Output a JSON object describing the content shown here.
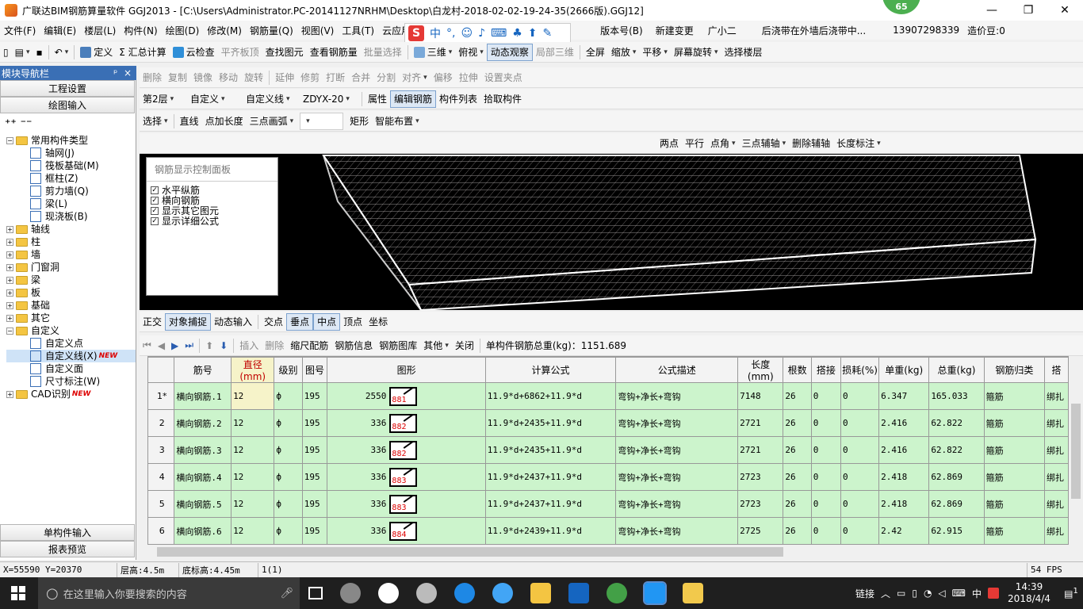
{
  "title": {
    "text": "广联达BIM钢筋算量软件 GGJ2013 - [C:\\Users\\Administrator.PC-20141127NRHM\\Desktop\\白龙村-2018-02-02-19-24-35(2666版).GGJ12]",
    "badge": "65",
    "minimize": "—",
    "restore": "❐",
    "close": "✕"
  },
  "menu": {
    "items": [
      "文件(F)",
      "编辑(E)",
      "楼层(L)",
      "构件(N)",
      "绘图(D)",
      "修改(M)",
      "钢筋量(Q)",
      "视图(V)",
      "工具(T)",
      "云应用"
    ],
    "right_items": [
      "版本号(B)",
      "新建变更",
      "广小二",
      "后浇带在外墙后浇带中...",
      "13907298339",
      "造价豆:0"
    ],
    "ime_s": "S",
    "ime_zh": "中"
  },
  "toolbar1": [
    "定义",
    "Σ 汇总计算",
    "云检查",
    "平齐板顶",
    "查找图元",
    "查看钢筋量",
    "批量选择",
    "三维",
    "俯视",
    "动态观察",
    "局部三维",
    "全屏",
    "缩放",
    "平移",
    "屏幕旋转",
    "选择楼层"
  ],
  "toolbar2": [
    "删除",
    "复制",
    "镜像",
    "移动",
    "旋转",
    "延伸",
    "修剪",
    "打断",
    "合并",
    "分割",
    "对齐",
    "偏移",
    "拉伸",
    "设置夹点"
  ],
  "toolbar3": {
    "floor": "第2层",
    "type": "自定义",
    "subtype": "自定义线",
    "name": "ZDYX-20",
    "buttons": [
      "属性",
      "编辑钢筋",
      "构件列表",
      "拾取构件"
    ]
  },
  "toolbar4": [
    "选择",
    "直线",
    "点加长度",
    "三点画弧",
    "矩形",
    "智能布置"
  ],
  "toolbar5": [
    "两点",
    "平行",
    "点角",
    "三点辅轴",
    "删除辅轴",
    "长度标注"
  ],
  "nav": {
    "header": "模块导航栏",
    "pin": "ᵖ",
    "close": "×",
    "buttons_top": [
      "工程设置",
      "绘图输入"
    ],
    "buttons_bottom": [
      "单构件输入",
      "报表预览"
    ],
    "common_group": "常用构件类型",
    "common_items": [
      "轴网(J)",
      "筏板基础(M)",
      "框柱(Z)",
      "剪力墙(Q)",
      "梁(L)",
      "现浇板(B)"
    ],
    "groups": [
      "轴线",
      "柱",
      "墙",
      "门窗洞",
      "梁",
      "板",
      "基础",
      "其它"
    ],
    "custom_group": "自定义",
    "custom_items": [
      "自定义点",
      "自定义线(X)",
      "自定义面",
      "尺寸标注(W)"
    ],
    "cad": "CAD识别",
    "new_tag": "NEW"
  },
  "panel": {
    "title": "钢筋显示控制面板",
    "checks": [
      "水平纵筋",
      "横向钢筋",
      "显示其它图元",
      "显示详细公式"
    ]
  },
  "snapbar": [
    "正交",
    "对象捕捉",
    "动态输入",
    "交点",
    "垂点",
    "中点",
    "顶点",
    "坐标"
  ],
  "gridbar": {
    "buttons": [
      "插入",
      "删除",
      "缩尺配筋",
      "钢筋信息",
      "钢筋图库",
      "其他",
      "关闭"
    ],
    "total_label": "单构件钢筋总重(kg)：1151.689"
  },
  "grid": {
    "headers": [
      "筋号",
      "直径(mm)",
      "级别",
      "图号",
      "图形",
      "计算公式",
      "公式描述",
      "长度(mm)",
      "根数",
      "搭接",
      "损耗(%)",
      "单重(kg)",
      "总重(kg)",
      "钢筋归类",
      "搭"
    ],
    "rows": [
      {
        "no": "1*",
        "name": "横向钢筋.1",
        "dia": "12",
        "grade": "ф",
        "fig": "195",
        "len_shape": "2550",
        "code": "881",
        "formula": "11.9*d+6862+11.9*d",
        "desc": "弯钩+净长+弯钩",
        "length": "7148",
        "count": "26",
        "lap": "0",
        "loss": "0",
        "unit": "6.347",
        "total": "165.033",
        "cat": "箍筋",
        "tie": "绑扎"
      },
      {
        "no": "2",
        "name": "横向钢筋.2",
        "dia": "12",
        "grade": "ф",
        "fig": "195",
        "len_shape": "336",
        "code": "882",
        "formula": "11.9*d+2435+11.9*d",
        "desc": "弯钩+净长+弯钩",
        "length": "2721",
        "count": "26",
        "lap": "0",
        "loss": "0",
        "unit": "2.416",
        "total": "62.822",
        "cat": "箍筋",
        "tie": "绑扎"
      },
      {
        "no": "3",
        "name": "横向钢筋.3",
        "dia": "12",
        "grade": "ф",
        "fig": "195",
        "len_shape": "336",
        "code": "882",
        "formula": "11.9*d+2435+11.9*d",
        "desc": "弯钩+净长+弯钩",
        "length": "2721",
        "count": "26",
        "lap": "0",
        "loss": "0",
        "unit": "2.416",
        "total": "62.822",
        "cat": "箍筋",
        "tie": "绑扎"
      },
      {
        "no": "4",
        "name": "横向钢筋.4",
        "dia": "12",
        "grade": "ф",
        "fig": "195",
        "len_shape": "336",
        "code": "883",
        "formula": "11.9*d+2437+11.9*d",
        "desc": "弯钩+净长+弯钩",
        "length": "2723",
        "count": "26",
        "lap": "0",
        "loss": "0",
        "unit": "2.418",
        "total": "62.869",
        "cat": "箍筋",
        "tie": "绑扎"
      },
      {
        "no": "5",
        "name": "横向钢筋.5",
        "dia": "12",
        "grade": "ф",
        "fig": "195",
        "len_shape": "336",
        "code": "883",
        "formula": "11.9*d+2437+11.9*d",
        "desc": "弯钩+净长+弯钩",
        "length": "2723",
        "count": "26",
        "lap": "0",
        "loss": "0",
        "unit": "2.418",
        "total": "62.869",
        "cat": "箍筋",
        "tie": "绑扎"
      },
      {
        "no": "6",
        "name": "横向钢筋.6",
        "dia": "12",
        "grade": "ф",
        "fig": "195",
        "len_shape": "336",
        "code": "884",
        "formula": "11.9*d+2439+11.9*d",
        "desc": "弯钩+净长+弯钩",
        "length": "2725",
        "count": "26",
        "lap": "0",
        "loss": "0",
        "unit": "2.42",
        "total": "62.915",
        "cat": "箍筋",
        "tie": "绑扎"
      }
    ]
  },
  "status": {
    "coords": "X=55590 Y=20370",
    "floor_height": "层高:4.5m",
    "base_height": "底标高:4.45m",
    "count": "1(1)",
    "fps": "54 FPS"
  },
  "taskbar": {
    "search_placeholder": "在这里输入你要搜索的内容",
    "link": "链接",
    "ime": "中",
    "time": "14:39",
    "date": "2018/4/4",
    "notif": "1"
  },
  "colors": {
    "grid_bg": "#ccf4cc",
    "nav_header": "#3a6fb5",
    "canvas_bg": "#000000"
  }
}
